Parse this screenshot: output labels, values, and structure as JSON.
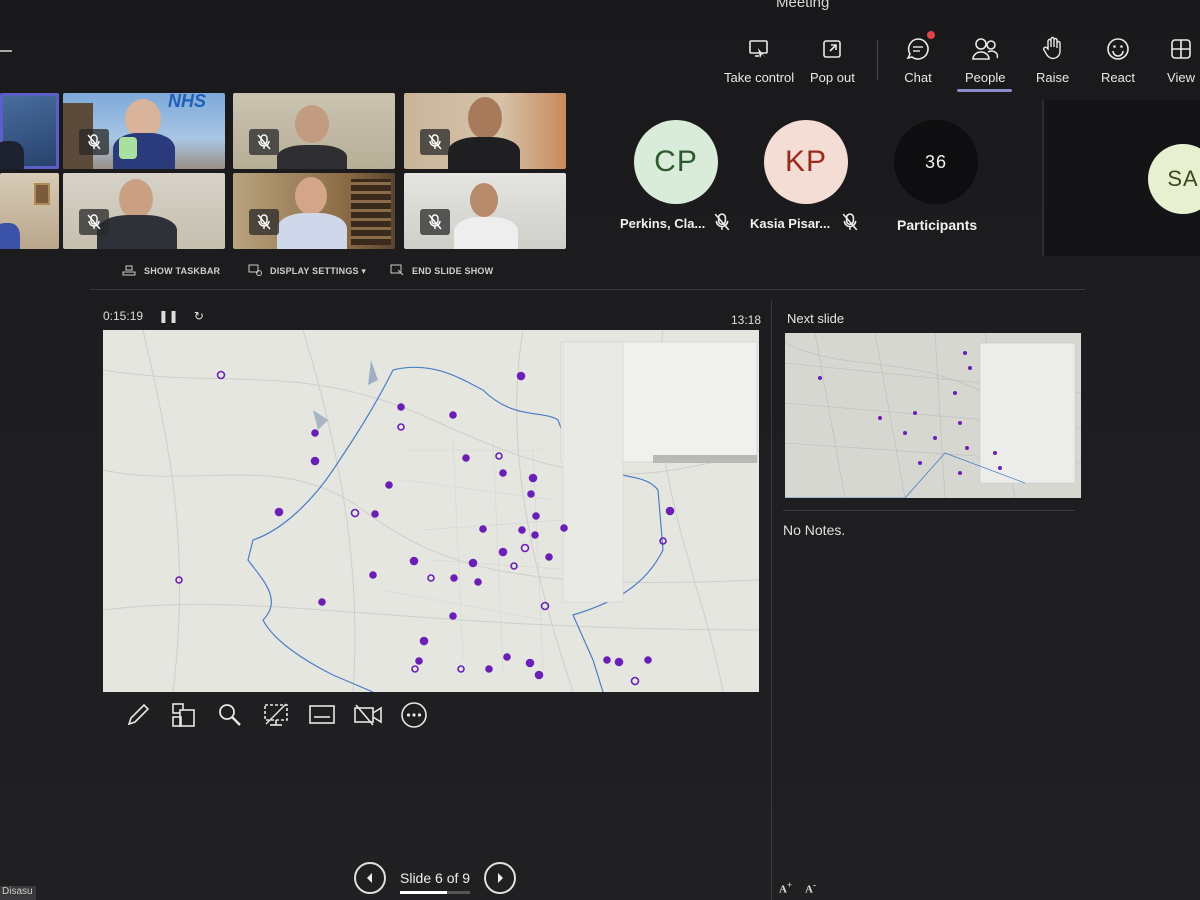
{
  "meeting": {
    "title": "Meeting"
  },
  "toolbar": {
    "take_control": "Take control",
    "pop_out": "Pop out",
    "chat": "Chat",
    "people": "People",
    "raise": "Raise",
    "react": "React",
    "view": "View"
  },
  "participants": {
    "p1": {
      "initials": "CP",
      "name": "Perkins, Cla..."
    },
    "p2": {
      "initials": "KP",
      "name": "Kasia Pisar..."
    },
    "count": "36",
    "count_label": "Participants",
    "side_initials": "SA"
  },
  "presenter": {
    "show_taskbar": "SHOW TASKBAR",
    "display_settings": "DISPLAY SETTINGS ▾",
    "end_show": "END SLIDE SHOW",
    "elapsed": "0:15:19",
    "clock": "13:18",
    "next_slide_label": "Next slide",
    "notes": "No Notes.",
    "slide_status": "Slide 6 of 9",
    "progress_fraction": 0.667
  },
  "tile_logo": "NHS",
  "corner_label": "Disasu",
  "colors": {
    "accent": "#5b5fc7",
    "marker": "#6a1fb5",
    "boundary": "#4a7fc4"
  }
}
